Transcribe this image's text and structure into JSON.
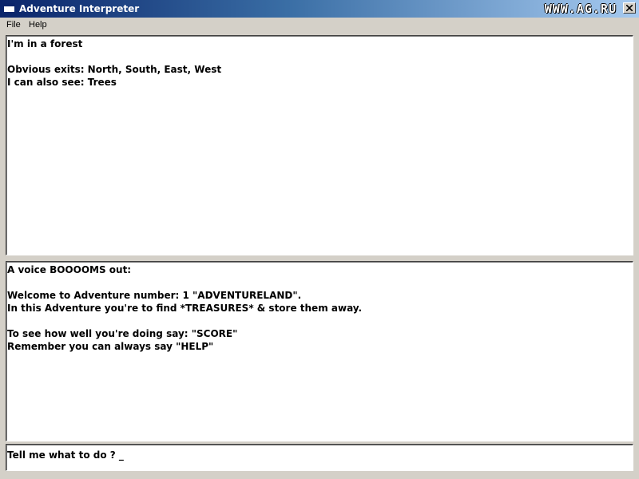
{
  "window": {
    "title": "Adventure Interpreter",
    "watermark": "WWW.AG.RU",
    "close_label": "x"
  },
  "menu": {
    "items": [
      {
        "label": "File"
      },
      {
        "label": "Help"
      }
    ]
  },
  "room_pane": {
    "lines": [
      "I'm in a forest",
      "",
      "Obvious exits: North, South, East, West",
      "I can also see: Trees"
    ]
  },
  "message_pane": {
    "lines": [
      "A voice BOOOOMS out:",
      "",
      "Welcome to Adventure number: 1 \"ADVENTURELAND\".",
      "In this Adventure you're to find *TREASURES* & store them away.",
      "",
      "To see how well you're doing say: \"SCORE\"",
      "Remember you can always say \"HELP\""
    ]
  },
  "input_pane": {
    "prompt": "Tell me what to do ? ",
    "cursor": "_"
  },
  "colors": {
    "title_bar_start": "#0a246a",
    "title_bar_end": "#a6caf0",
    "window_face": "#d4d0c8",
    "pane_background": "#ffffff",
    "text": "#000000"
  },
  "icons": {
    "app": "window-icon",
    "close": "close-icon"
  }
}
